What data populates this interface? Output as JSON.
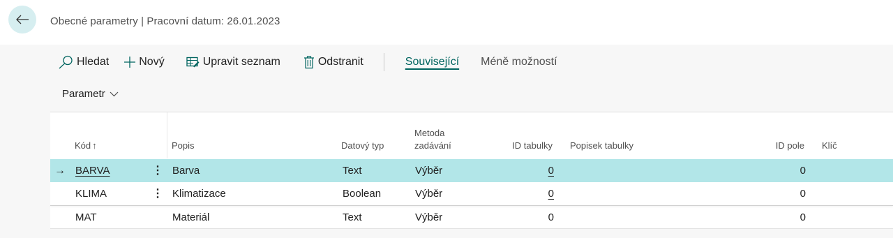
{
  "header": {
    "title": "Obecné parametry | Pracovní datum: 26.01.2023"
  },
  "toolbar": {
    "search": "Hledat",
    "new": "Nový",
    "edit_list": "Upravit seznam",
    "delete": "Odstranit",
    "related": "Související",
    "fewer_options": "Méně možností"
  },
  "filter": {
    "label": "Parametr"
  },
  "table": {
    "columns": {
      "code": "Kód",
      "sort_indicator": "↑",
      "description": "Popis",
      "data_type": "Datový typ",
      "entry_method_1": "Metoda",
      "entry_method_2": "zadávání",
      "table_id": "ID tabulky",
      "table_caption": "Popisek tabulky",
      "field_id": "ID pole",
      "key": "Klíč"
    },
    "rows": [
      {
        "code": "BARVA",
        "description": "Barva",
        "data_type": "Text",
        "entry_method": "Výběr",
        "table_id": "0",
        "table_caption": "",
        "field_id": "0",
        "key": ""
      },
      {
        "code": "KLIMA",
        "description": "Klimatizace",
        "data_type": "Boolean",
        "entry_method": "Výběr",
        "table_id": "0",
        "table_caption": "",
        "field_id": "0",
        "key": ""
      },
      {
        "code": "MAT",
        "description": "Materiál",
        "data_type": "Text",
        "entry_method": "Výběr",
        "table_id": "0",
        "table_caption": "",
        "field_id": "0",
        "key": ""
      }
    ],
    "selected_row_marker": "→",
    "row_menu_glyph": "⋮"
  },
  "colors": {
    "accent": "#00645f",
    "selected_row": "#b2e6e8",
    "back_button": "#d6eef0"
  }
}
